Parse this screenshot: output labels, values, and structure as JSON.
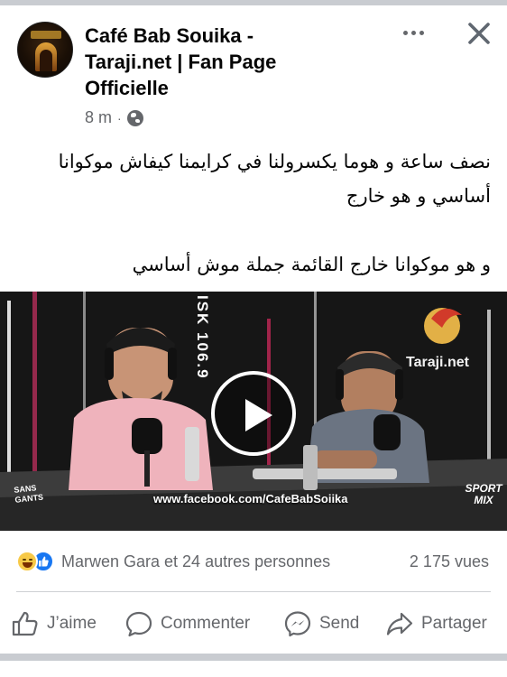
{
  "post": {
    "page_name": "Café Bab Souika - Taraji.net | Fan Page Officielle",
    "time": "8 m",
    "meta_separator": "·",
    "privacy_icon": "globe-icon",
    "text_lines": [
      "نصف ساعة و هوما يكسرولنا في كرايمنا كيفاش موكوانا",
      "أساسي و هو خارج",
      "و هو موكوانا خارج القائمة جملة موش أساسي"
    ]
  },
  "video": {
    "overlay_url": "www.facebook.com/CafeBabSoiika",
    "brand_logo": "Taraji.net",
    "corner_logo_right": "SPORT MIX",
    "corner_logo_left": "SANS GANTS",
    "station_text": "ISK 106.9",
    "play_icon": "play-icon"
  },
  "stats": {
    "reaction_icons": [
      "haha-icon",
      "like-icon"
    ],
    "reactors": "Marwen Gara et 24 autres personnes",
    "views": "2 175 vues"
  },
  "actions": [
    {
      "label": "J’aime",
      "icon": "thumbs-up-icon"
    },
    {
      "label": "Commenter",
      "icon": "comment-icon"
    },
    {
      "label": "Send",
      "icon": "messenger-icon"
    },
    {
      "label": "Partager",
      "icon": "share-icon"
    }
  ],
  "colors": {
    "accent": "#1877f2",
    "secondary_text": "#65676b",
    "separator": "#c9ccd1"
  }
}
